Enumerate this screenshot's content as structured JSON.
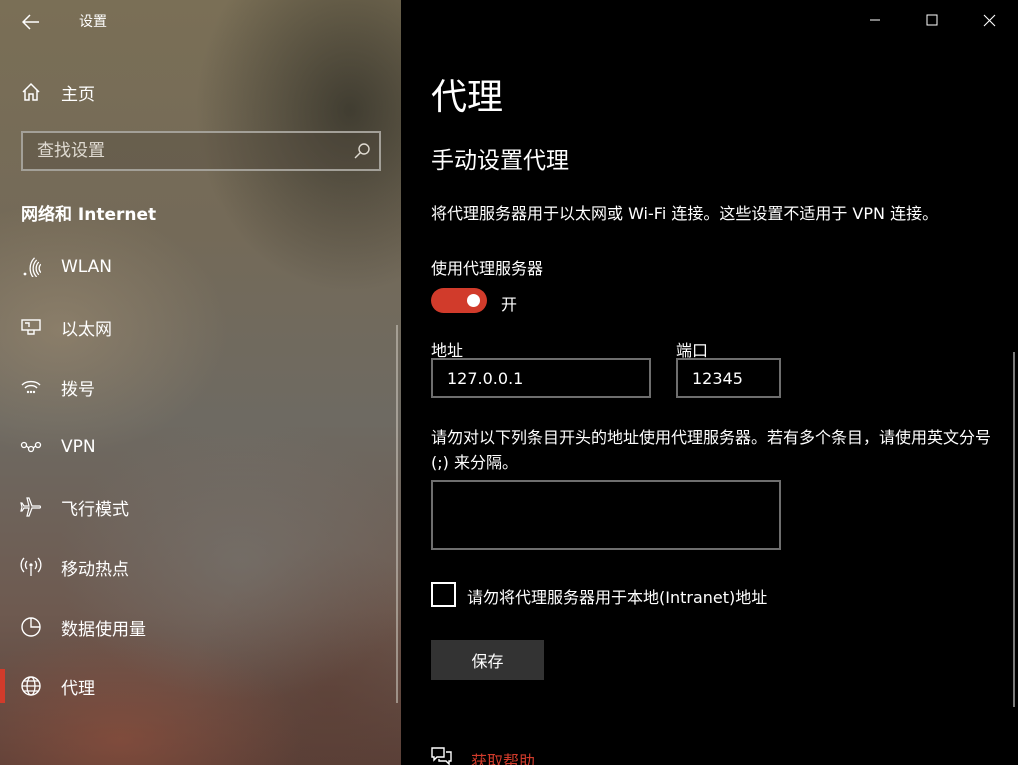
{
  "window": {
    "title": "设置",
    "controls": {
      "minimize": "minimize",
      "maximize": "maximize",
      "close": "close"
    }
  },
  "sidebar": {
    "home_label": "主页",
    "search": {
      "placeholder": "查找设置",
      "value": ""
    },
    "section_title": "网络和 Internet",
    "items": [
      {
        "label": "WLAN",
        "icon": "wifi-icon"
      },
      {
        "label": "以太网",
        "icon": "ethernet-icon"
      },
      {
        "label": "拨号",
        "icon": "dialup-icon"
      },
      {
        "label": "VPN",
        "icon": "vpn-icon"
      },
      {
        "label": "飞行模式",
        "icon": "airplane-icon"
      },
      {
        "label": "移动热点",
        "icon": "hotspot-icon"
      },
      {
        "label": "数据使用量",
        "icon": "data-usage-icon"
      },
      {
        "label": "代理",
        "icon": "globe-icon",
        "selected": true
      }
    ]
  },
  "main": {
    "page_title": "代理",
    "section_title": "手动设置代理",
    "description": "将代理服务器用于以太网或 Wi-Fi 连接。这些设置不适用于 VPN 连接。",
    "use_proxy": {
      "label": "使用代理服务器",
      "state_text": "开",
      "on": true
    },
    "address": {
      "label": "地址",
      "value": "127.0.0.1"
    },
    "port": {
      "label": "端口",
      "value": "12345"
    },
    "exceptions": {
      "label": "请勿对以下列条目开头的地址使用代理服务器。若有多个条目，请使用英文分号 (;) 来分隔。",
      "value": ""
    },
    "bypass_local": {
      "label": "请勿将代理服务器用于本地(Intranet)地址",
      "checked": false
    },
    "save_label": "保存",
    "help_link": "获取帮助"
  },
  "colors": {
    "accent": "#d13b2b",
    "background": "#000000",
    "button": "#333333"
  }
}
